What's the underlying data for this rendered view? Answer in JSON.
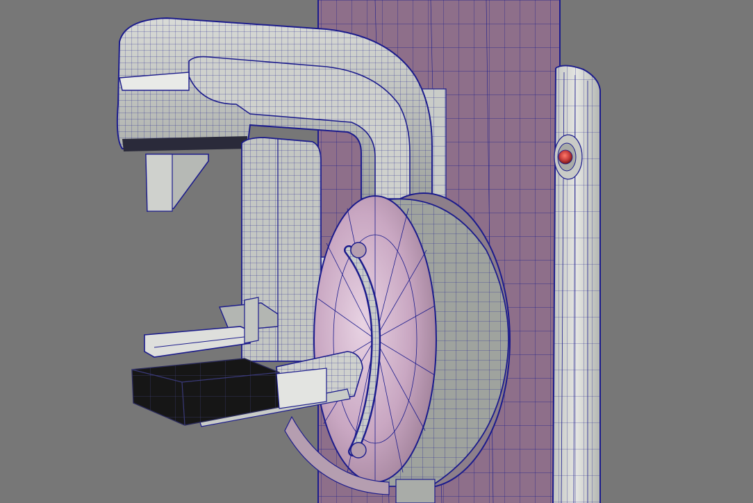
{
  "viewport": {
    "background": "#777777",
    "mesh_colors": {
      "wire": "#1b1b8c",
      "grey_face": "#b9bdb8",
      "grey_light": "#d4d6d2",
      "grey_dark": "#8d918c",
      "pink_face": "#c8a3be",
      "pink_light": "#e2cbdc",
      "pink_dark": "#9c7c95",
      "black_face": "#181818",
      "red_light": "#c23a3a"
    },
    "objects": [
      "rear-column",
      "side-column",
      "c-arm-head",
      "gantry-body",
      "rotation-disk",
      "compression-paddle",
      "detector-tray",
      "indicator-light"
    ]
  }
}
